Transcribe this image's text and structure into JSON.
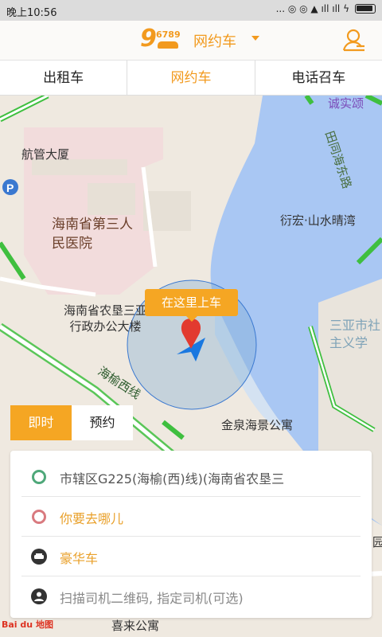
{
  "status_bar": {
    "time": "晚上10:56",
    "indicators": "... ◎ ◎ ▲ ıll ıll ϟ"
  },
  "header": {
    "logo_big": "9",
    "logo_num": "6789",
    "title": "网约车"
  },
  "tabs": [
    {
      "label": "出租车"
    },
    {
      "label": "网约车"
    },
    {
      "label": "电话召车"
    }
  ],
  "map": {
    "labels": {
      "top_right_poi": "诚实颂",
      "building1": "航管大厦",
      "hospital": "海南省第三人民医院",
      "road_right": "田同海东路",
      "residential": "衍宏·山水晴湾",
      "office": "海南省农垦三亚\n行政办公大楼",
      "school": "三亚市社\n主义学",
      "road_g225": "海榆西线",
      "jinquan": "金泉海景公寓",
      "bottom_label": "喜来公寓",
      "right_edge": "园"
    },
    "pickup_tip": "在这里上车"
  },
  "mode_toggle": {
    "now": "即时",
    "reserve": "预约"
  },
  "panel": {
    "start": "市辖区G225(海榆(西)线)(海南省农垦三",
    "destination_placeholder": "你要去哪儿",
    "car_type": "豪华车",
    "driver_scan": "扫描司机二维码, 指定司机(可选)"
  },
  "baidu_logo": "Bai du 地图",
  "colors": {
    "accent": "#f29a1e",
    "river": "#a9c7f3",
    "road_green": "#3fbf3f",
    "hospital_area": "#f2d8d8"
  }
}
